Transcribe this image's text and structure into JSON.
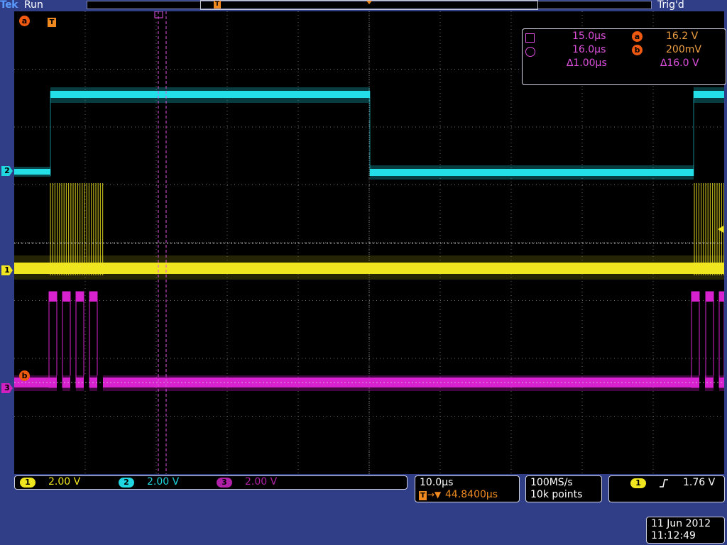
{
  "header": {
    "brand": "Tek",
    "run_state": "Run",
    "trigger_status": "Trig'd",
    "record_trigger_marker": "T"
  },
  "markers": {
    "trigger_position_label": "T",
    "cursor_a_label": "a",
    "cursor_b_label": "b",
    "ch1_label": "1",
    "ch2_label": "2",
    "ch3_label": "3"
  },
  "cursor_readout": {
    "cursor1_time": "15.0µs",
    "cursor2_time": "16.0µs",
    "delta_time": "∆1.00µs",
    "cursor_a_badge": "a",
    "cursor_b_badge": "b",
    "cursor_a_voltage": "16.2 V",
    "cursor_b_voltage": "200mV",
    "delta_voltage": "∆16.0 V"
  },
  "channels": [
    {
      "number": "1",
      "scale": "2.00 V",
      "color": "#f0e620"
    },
    {
      "number": "2",
      "scale": "2.00 V",
      "color": "#20d6e0"
    },
    {
      "number": "3",
      "scale": "2.00 V",
      "color": "#d020c0"
    }
  ],
  "horizontal": {
    "time_per_div": "10.0µs",
    "trigger_position_prefix": "T",
    "position_arrow": "→▼",
    "trigger_position": "44.8400µs"
  },
  "acquisition": {
    "sample_rate": "100MS/s",
    "record_length": "10k points"
  },
  "trigger": {
    "source": "1",
    "slope_icon": "rising-edge",
    "level": "1.76 V"
  },
  "datetime": {
    "date": "11 Jun 2012",
    "time": "11:12:49"
  },
  "colors": {
    "background": "#2f3e86",
    "ch1": "#f0e620",
    "ch2": "#20d6e0",
    "ch3": "#d020c0",
    "cursor": "#e050e0",
    "accent": "#f08a20"
  }
}
